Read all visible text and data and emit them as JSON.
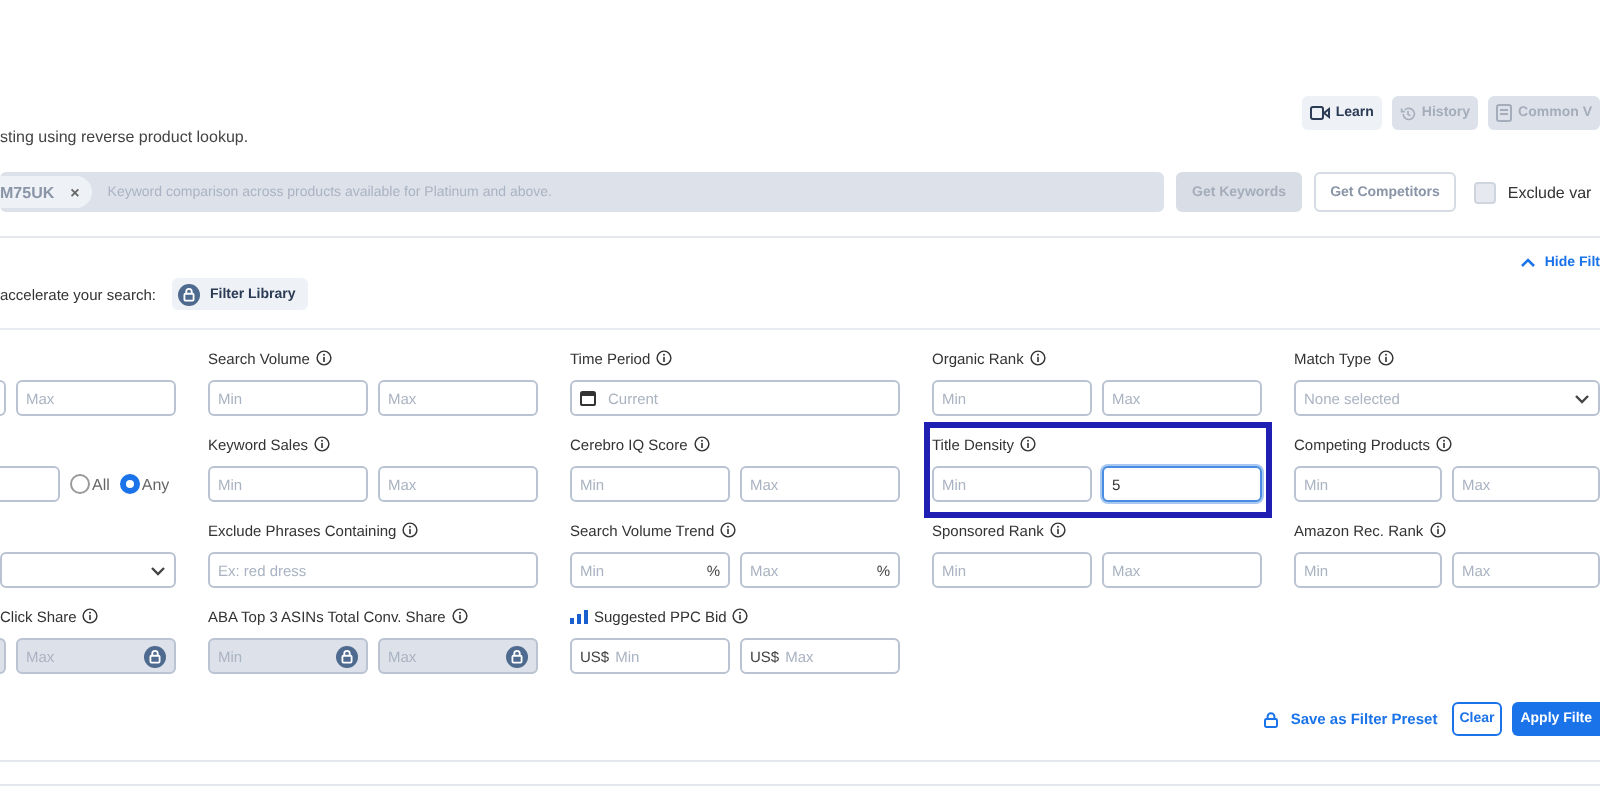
{
  "header": {
    "subtitle": "sting using reverse product lookup.",
    "actions": [
      {
        "kind": "video",
        "label": "Learn",
        "disabled": false
      },
      {
        "kind": "history",
        "label": "History",
        "disabled": true
      },
      {
        "kind": "doc",
        "label": "Common V",
        "disabled": true
      }
    ]
  },
  "search": {
    "chip": "M75UK",
    "chip_close": "×",
    "placeholder": "Keyword comparison across products available for Platinum and above.",
    "buttons": [
      {
        "label": "Get Keywords",
        "disabled": true
      },
      {
        "label": "Get Competitors",
        "disabled": false
      }
    ],
    "exclude": {
      "label": "Exclude var",
      "checked": false
    }
  },
  "hide_filters": "Hide Filt",
  "library": {
    "text": "accelerate your search:",
    "button": "Filter Library"
  },
  "filter_rows": [
    [
      {
        "kind": "range",
        "cut": true,
        "max": {
          "placeholder": "Max"
        }
      },
      {
        "kind": "range",
        "label": "Search Volume",
        "min": {
          "placeholder": "Min"
        },
        "max": {
          "placeholder": "Max"
        }
      },
      {
        "kind": "date",
        "label": "Time Period",
        "placeholder": "Current"
      },
      {
        "kind": "range",
        "label": "Organic Rank",
        "min": {
          "placeholder": "Min"
        },
        "max": {
          "placeholder": "Max"
        }
      },
      {
        "kind": "select",
        "label": "Match Type",
        "placeholder": "None selected"
      }
    ],
    [
      {
        "kind": "radio",
        "cut": true,
        "options": [
          {
            "label": "All",
            "selected": false
          },
          {
            "label": "Any",
            "selected": true
          }
        ]
      },
      {
        "kind": "range",
        "label": "Keyword Sales",
        "min": {
          "placeholder": "Min"
        },
        "max": {
          "placeholder": "Max"
        }
      },
      {
        "kind": "range",
        "label": "Cerebro IQ Score",
        "min": {
          "placeholder": "Min"
        },
        "max": {
          "placeholder": "Max"
        }
      },
      {
        "kind": "range",
        "label": "Title Density",
        "highlighted": true,
        "min": {
          "placeholder": "Min"
        },
        "max": {
          "value": "5",
          "focused": true
        }
      },
      {
        "kind": "range",
        "label": "Competing Products",
        "min": {
          "placeholder": "Min"
        },
        "max": {
          "placeholder": "Max"
        }
      }
    ],
    [
      {
        "kind": "select"
      },
      {
        "kind": "text",
        "label": "Exclude Phrases Containing",
        "placeholder": "Ex: red dress"
      },
      {
        "kind": "range",
        "label": "Search Volume Trend",
        "min": {
          "placeholder": "Min",
          "suffix": "%"
        },
        "max": {
          "placeholder": "Max",
          "suffix": "%"
        }
      },
      {
        "kind": "range",
        "label": "Sponsored Rank",
        "min": {
          "placeholder": "Min"
        },
        "max": {
          "placeholder": "Max"
        }
      },
      {
        "kind": "range",
        "label": "Amazon Rec. Rank",
        "min": {
          "placeholder": "Min"
        },
        "max": {
          "placeholder": "Max"
        }
      }
    ],
    [
      {
        "kind": "range",
        "cut": true,
        "label": "Click Share",
        "min": {
          "locked": true
        },
        "max": {
          "placeholder": "Max",
          "locked": true
        }
      },
      {
        "kind": "range",
        "label": "ABA Top 3 ASINs Total Conv. Share",
        "min": {
          "placeholder": "Min",
          "locked": true
        },
        "max": {
          "placeholder": "Max",
          "locked": true
        }
      },
      {
        "kind": "range",
        "label": "Suggested PPC Bid",
        "badge": true,
        "min": {
          "placeholder": "Min",
          "prefix": "US$"
        },
        "max": {
          "placeholder": "Max",
          "prefix": "US$"
        }
      },
      {
        "kind": "empty"
      },
      {
        "kind": "empty"
      }
    ]
  ],
  "footer": {
    "save": "Save as Filter Preset",
    "clear": "Clear",
    "apply": "Apply Filte"
  }
}
